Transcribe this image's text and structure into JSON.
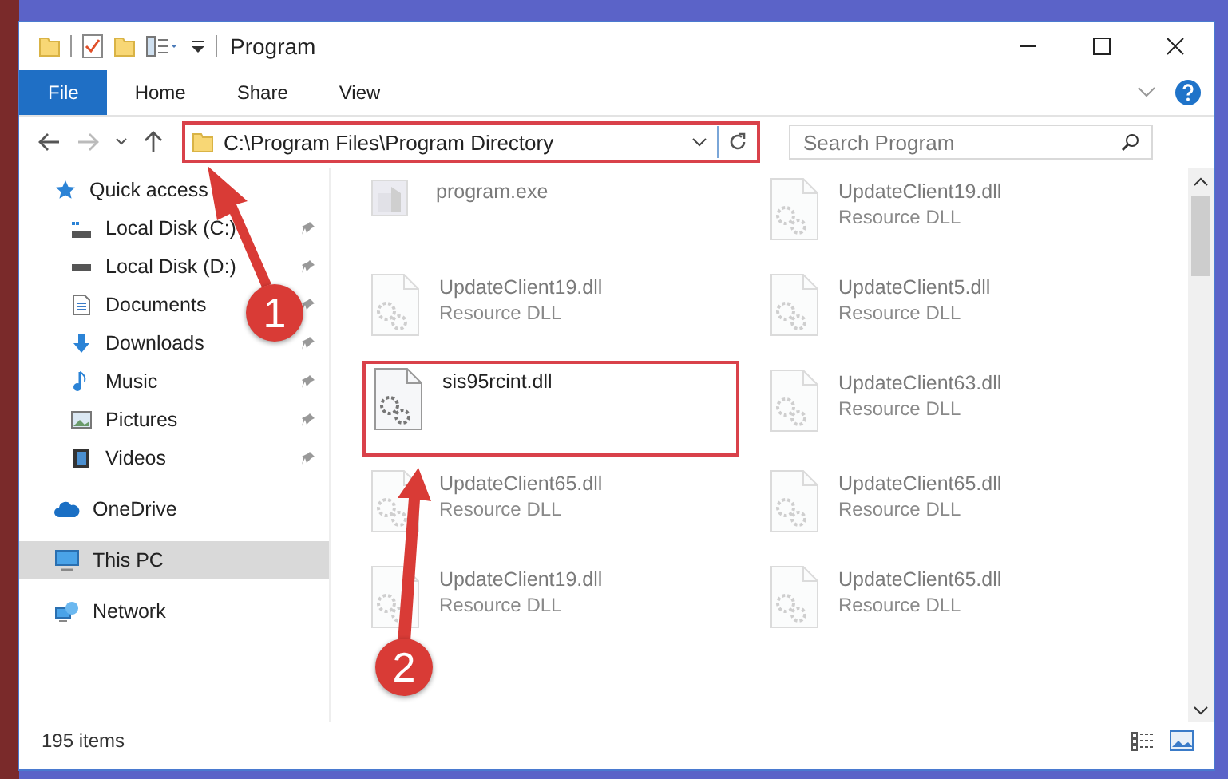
{
  "window": {
    "title": "Program"
  },
  "ribbon_tabs": [
    {
      "label": "File",
      "selected": true
    },
    {
      "label": "Home",
      "selected": false
    },
    {
      "label": "Share",
      "selected": false
    },
    {
      "label": "View",
      "selected": false
    }
  ],
  "address": {
    "path": "C:\\Program Files\\Program Directory",
    "highlighted": true
  },
  "search": {
    "placeholder": "Search Program"
  },
  "sidebar": {
    "items": [
      {
        "label": "Quick access",
        "kind": "star",
        "pinned": false,
        "selected": false,
        "children": [
          {
            "label": "Local Disk (C:)",
            "kind": "system-drive",
            "pinned": true,
            "selected": false
          },
          {
            "label": "Local Disk (D:)",
            "kind": "drive",
            "pinned": true,
            "selected": false
          },
          {
            "label": "Documents",
            "kind": "document",
            "pinned": true,
            "selected": false
          },
          {
            "label": "Downloads",
            "kind": "download",
            "pinned": true,
            "selected": false
          },
          {
            "label": "Music",
            "kind": "music",
            "pinned": true,
            "selected": false
          },
          {
            "label": "Pictures",
            "kind": "picture",
            "pinned": true,
            "selected": false
          },
          {
            "label": "Videos",
            "kind": "video",
            "pinned": true,
            "selected": false
          }
        ]
      },
      {
        "label": "OneDrive",
        "kind": "cloud",
        "pinned": false,
        "selected": false
      },
      {
        "label": "This PC",
        "kind": "computer",
        "pinned": false,
        "selected": true
      },
      {
        "label": "Network",
        "kind": "network",
        "pinned": false,
        "selected": false
      }
    ]
  },
  "files": [
    {
      "name": "program.exe",
      "kind": "exe",
      "dimmed": true,
      "highlighted": false
    },
    {
      "name": "UpdateClient19.dll",
      "type": "Resource DLL",
      "kind": "dll",
      "dimmed": true,
      "highlighted": false
    },
    {
      "name": "UpdateClient19.dll",
      "type": "Resource DLL",
      "kind": "dll",
      "dimmed": true,
      "highlighted": false
    },
    {
      "name": "UpdateClient5.dll",
      "type": "Resource DLL",
      "kind": "dll",
      "dimmed": true,
      "highlighted": false
    },
    {
      "name": "sis95rcint.dll",
      "kind": "dll",
      "dimmed": false,
      "highlighted": true
    },
    {
      "name": "UpdateClient63.dll",
      "type": "Resource DLL",
      "kind": "dll",
      "dimmed": true,
      "highlighted": false
    },
    {
      "name": "UpdateClient65.dll",
      "type": "Resource DLL",
      "kind": "dll",
      "dimmed": true,
      "highlighted": false
    },
    {
      "name": "UpdateClient65.dll",
      "type": "Resource DLL",
      "kind": "dll",
      "dimmed": true,
      "highlighted": false
    },
    {
      "name": "UpdateClient19.dll",
      "type": "Resource DLL",
      "kind": "dll",
      "dimmed": true,
      "highlighted": false
    },
    {
      "name": "UpdateClient65.dll",
      "type": "Resource DLL",
      "kind": "dll",
      "dimmed": true,
      "highlighted": false
    }
  ],
  "status_bar": {
    "item_count": "195 items"
  },
  "callouts": [
    {
      "label": "1"
    },
    {
      "label": "2"
    }
  ]
}
